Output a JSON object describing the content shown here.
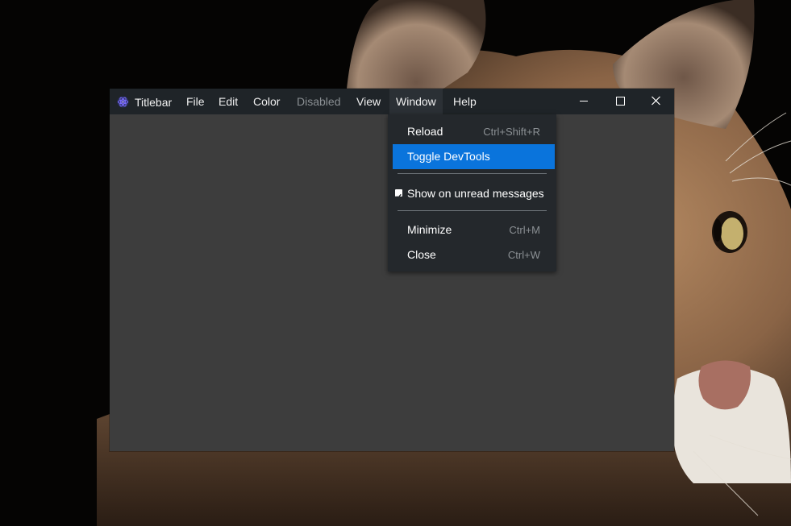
{
  "window": {
    "title": "Titlebar",
    "icon": "electron-atom-icon"
  },
  "menubar": {
    "items": [
      {
        "label": "File",
        "disabled": false
      },
      {
        "label": "Edit",
        "disabled": false
      },
      {
        "label": "Color",
        "disabled": false
      },
      {
        "label": "Disabled",
        "disabled": true
      },
      {
        "label": "View",
        "disabled": false
      },
      {
        "label": "Window",
        "disabled": false,
        "open": true
      },
      {
        "label": "Help",
        "disabled": false
      }
    ]
  },
  "window_controls": {
    "minimize": "minimize-icon",
    "maximize": "maximize-icon",
    "close": "close-icon"
  },
  "window_menu": {
    "items": [
      {
        "label": "Reload",
        "accelerator": "Ctrl+Shift+R"
      },
      {
        "label": "Toggle DevTools",
        "accelerator": "",
        "highlighted": true
      },
      {
        "label": "Show on unread messages",
        "checked": true
      },
      {
        "label": "Minimize",
        "accelerator": "Ctrl+M"
      },
      {
        "label": "Close",
        "accelerator": "Ctrl+W"
      }
    ]
  },
  "colors": {
    "titlebar_bg": "#1f2428",
    "content_bg": "#3d3d3d",
    "menu_bg": "#24282c",
    "highlight": "#0a74dc",
    "disabled_text": "#8a8f93"
  }
}
